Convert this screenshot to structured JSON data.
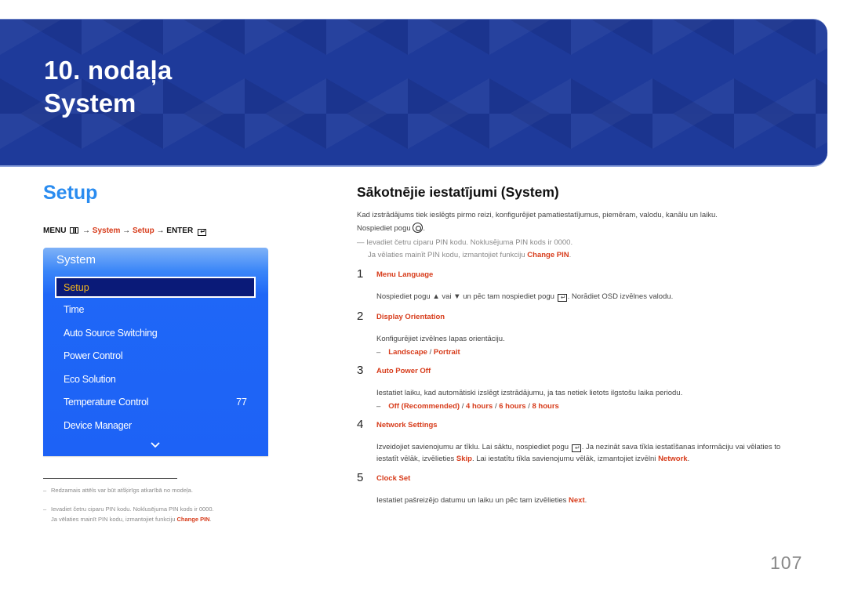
{
  "banner": {
    "chapter": "10. nodaļa",
    "title": "System"
  },
  "left": {
    "heading": "Setup",
    "path": {
      "menu": "MENU",
      "arrow": "→",
      "system": "System",
      "setup": "Setup",
      "enter": "ENTER",
      "enter_glyph": "↵"
    },
    "osd": {
      "title": "System",
      "selected": "Setup",
      "items": [
        {
          "label": "Time"
        },
        {
          "label": "Auto Source Switching"
        },
        {
          "label": "Power Control"
        },
        {
          "label": "Eco Solution"
        },
        {
          "label": "Temperature Control",
          "value": "77"
        },
        {
          "label": "Device Manager"
        }
      ],
      "more_icon": "chevron-down-icon"
    },
    "footnotes": [
      {
        "dash": "–",
        "text": "Redzamais attēls var būt atšķirīgs atkarībā no modeļa."
      },
      {
        "dash": "–",
        "line1": "Ievadiet četru ciparu PIN kodu. Noklusējuma PIN kods ir 0000.",
        "line2_pre": "Ja vēlaties mainīt PIN kodu, izmantojiet funkciju ",
        "line2_link": "Change PIN",
        "line2_post": "."
      }
    ]
  },
  "right": {
    "title": "Sākotnējie iestatījumi (System)",
    "intro1": "Kad izstrādājums tiek ieslēgts pirmo reizi, konfigurējiet pamatiestatījumus, piemēram, valodu, kanālu un laiku.",
    "intro2_pre": "Nospiediet pogu ",
    "intro2_post": ".",
    "note_dash": "—",
    "note1": "Ievadiet četru ciparu PIN kodu. Noklusējuma PIN kods ir 0000.",
    "note2_pre": "Ja vēlaties mainīt PIN kodu, izmantojiet funkciju ",
    "note2_link": "Change PIN",
    "note2_post": ".",
    "steps": [
      {
        "num": "1",
        "title": "Menu Language",
        "desc_pre": "Nospiediet pogu ",
        "up": "▲",
        "mid": " vai ",
        "down": "▼",
        "mid2": " un pēc tam nospiediet pogu ",
        "enter": "↵",
        "desc_post": ". Norādiet OSD izvēlnes valodu."
      },
      {
        "num": "2",
        "title": "Display Orientation",
        "desc": "Konfigurējiet izvēlnes lapas orientāciju.",
        "options_dash": "–",
        "options": [
          "Landscape",
          "Portrait"
        ],
        "sep": " / "
      },
      {
        "num": "3",
        "title": "Auto Power Off",
        "desc": "Iestatiet laiku, kad automātiski izslēgt izstrādājumu, ja tas netiek lietots ilgstošu laika periodu.",
        "options_dash": "–",
        "options": [
          "Off (Recommended)",
          "4 hours",
          "6 hours",
          "8 hours"
        ],
        "sep": " / "
      },
      {
        "num": "4",
        "title": "Network Settings",
        "line1_pre": "Izveidojiet savienojumu ar tīklu. Lai sāktu, nospiediet pogu ",
        "enter": "↵",
        "line1_post": ". Ja nezināt sava tīkla iestatīšanas informāciju vai vēlaties to",
        "line2_pre": "iestatīt vēlāk, izvēlieties ",
        "skip": "Skip",
        "line2_mid": ". Lai iestatītu tīkla savienojumu vēlāk, izmantojiet izvēlni ",
        "network": "Network",
        "line2_post": "."
      },
      {
        "num": "5",
        "title": "Clock Set",
        "desc_pre": "Iestatiet pašreizējo datumu un laiku un pēc tam izvēlieties ",
        "next": "Next",
        "desc_post": "."
      }
    ]
  },
  "page_number": "107",
  "colors": {
    "accent_red": "#d73b1a",
    "heading_blue": "#2a8cf0",
    "osd_blue": "#1d62f6",
    "banner_blue": "#1e3a9a",
    "selected_text": "#f8b81a"
  }
}
